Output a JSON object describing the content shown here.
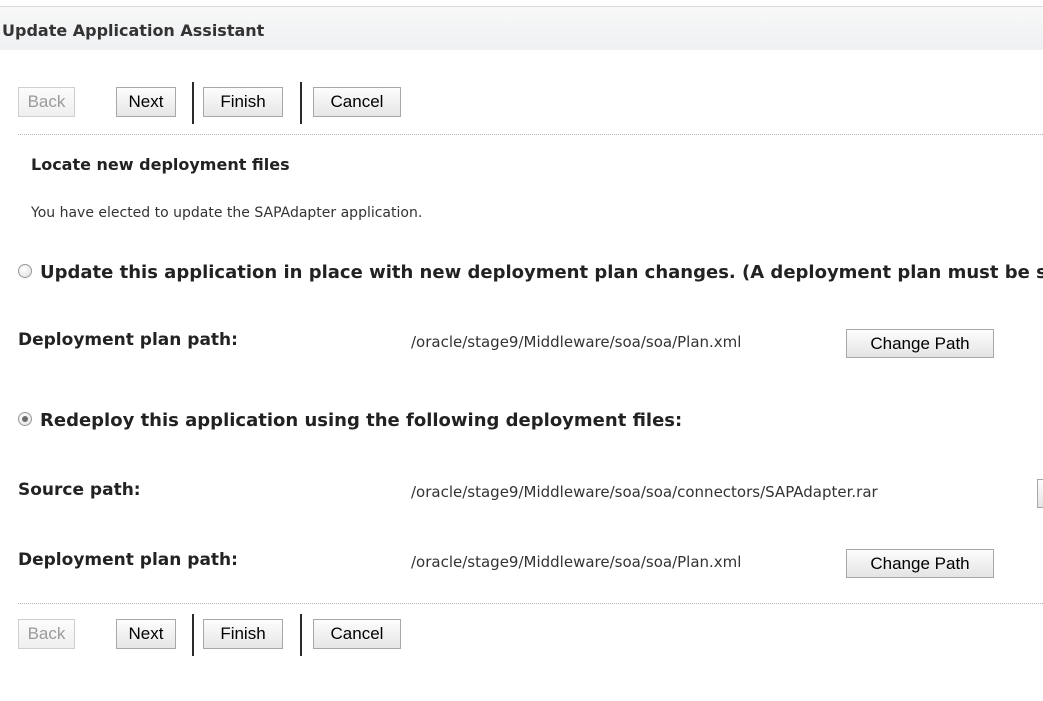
{
  "header": {
    "title": "Update Application Assistant"
  },
  "toolbar_top": {
    "back": "Back",
    "next": "Next",
    "finish": "Finish",
    "cancel": "Cancel"
  },
  "section": {
    "title": "Locate new deployment files",
    "intro": "You have elected to update the SAPAdapter application."
  },
  "options": {
    "update_in_place": {
      "label": "Update this application in place with new deployment plan changes. (A deployment plan must be specified for this option.)",
      "selected": false,
      "plan_label": "Deployment plan path:",
      "plan_value": "/oracle/stage9/Middleware/soa/soa/Plan.xml",
      "change_label": "Change Path"
    },
    "redeploy": {
      "label": "Redeploy this application using the following deployment files:",
      "selected": true,
      "source_label": "Source path:",
      "source_value": "/oracle/stage9/Middleware/soa/soa/connectors/SAPAdapter.rar",
      "plan_label": "Deployment plan path:",
      "plan_value": "/oracle/stage9/Middleware/soa/soa/Plan.xml",
      "change_label": "Change Path"
    }
  },
  "toolbar_bottom": {
    "back": "Back",
    "next": "Next",
    "finish": "Finish",
    "cancel": "Cancel"
  }
}
